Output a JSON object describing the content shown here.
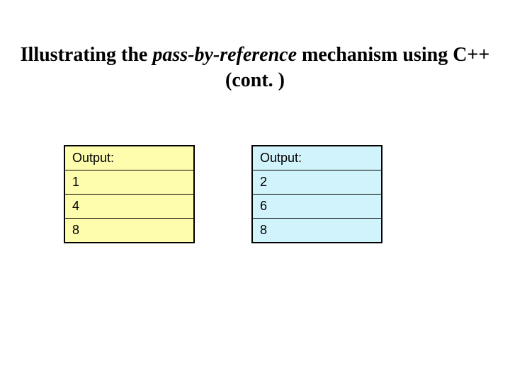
{
  "title": {
    "prefix": "Illustrating the ",
    "italic": "pass-by-reference",
    "suffix": " mechanism using C++ (cont. )"
  },
  "left_box": {
    "header": "Output:",
    "rows": [
      "1",
      "4",
      "8"
    ]
  },
  "right_box": {
    "header": "Output:",
    "rows": [
      "2",
      "6",
      "8"
    ]
  }
}
